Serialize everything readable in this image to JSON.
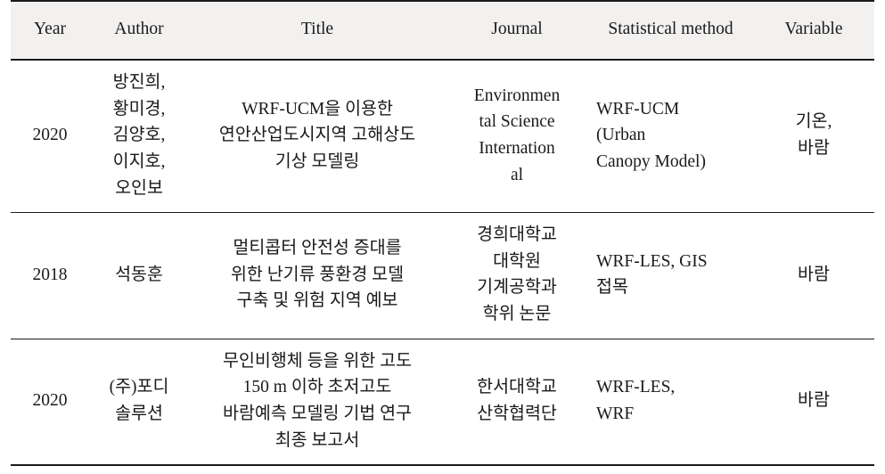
{
  "table": {
    "headers": [
      {
        "id": "year",
        "label": "Year"
      },
      {
        "id": "author",
        "label": "Author"
      },
      {
        "id": "title",
        "label": "Title"
      },
      {
        "id": "journal",
        "label": "Journal"
      },
      {
        "id": "method",
        "label": "Statistical method"
      },
      {
        "id": "variable",
        "label": "Variable"
      }
    ],
    "header_background": "#f2f1f0",
    "rule_color": "#1a1a1a",
    "rows": [
      {
        "year": "2020",
        "author_lines": [
          "방진희,",
          "황미경,",
          "김양호,",
          "이지호,",
          "오인보"
        ],
        "author": "방진희, 황미경, 김양호, 이지호, 오인보",
        "title_lines": [
          "WRF-UCM을 이용한",
          "연안산업도시지역 고해상도",
          "기상 모델링"
        ],
        "title": "WRF-UCM을 이용한 연안산업도시지역 고해상도 기상 모델링",
        "journal_lines": [
          "Environmen",
          "tal Science",
          "Internation",
          "al"
        ],
        "journal": "Environmental Science International",
        "method_lines": [
          "WRF-UCM",
          "(Urban",
          "Canopy Model)"
        ],
        "method": "WRF-UCM (Urban Canopy Model)",
        "variable_lines": [
          "기온,",
          "바람"
        ],
        "variable": "기온, 바람"
      },
      {
        "year": "2018",
        "author_lines": [
          "석동훈"
        ],
        "author": "석동훈",
        "title_lines": [
          "멀티콥터 안전성 증대를",
          "위한 난기류 풍환경 모델",
          "구축 및 위험 지역 예보"
        ],
        "title": "멀티콥터 안전성 증대를 위한 난기류 풍환경 모델 구축 및 위험 지역 예보",
        "journal_lines": [
          "경희대학교",
          "대학원",
          "기계공학과",
          "학위 논문"
        ],
        "journal": "경희대학교 대학원 기계공학과 학위 논문",
        "method_lines": [
          "WRF-LES, GIS",
          "접목"
        ],
        "method": "WRF-LES, GIS 접목",
        "variable_lines": [
          "바람"
        ],
        "variable": "바람"
      },
      {
        "year": "2020",
        "author_lines": [
          "(주)포디",
          "솔루션"
        ],
        "author": "(주)포디 솔루션",
        "title_lines": [
          "무인비행체 등을 위한 고도",
          "150 m 이하 초저고도",
          "바람예측 모델링 기법 연구",
          "최종 보고서"
        ],
        "title": "무인비행체 등을 위한 고도 150 m 이하 초저고도 바람예측 모델링 기법 연구 최종 보고서",
        "journal_lines": [
          "한서대학교",
          "산학협력단"
        ],
        "journal": "한서대학교 산학협력단",
        "method_lines": [
          "WRF-LES,",
          "WRF"
        ],
        "method": "WRF-LES, WRF",
        "variable_lines": [
          "바람"
        ],
        "variable": "바람"
      }
    ]
  }
}
